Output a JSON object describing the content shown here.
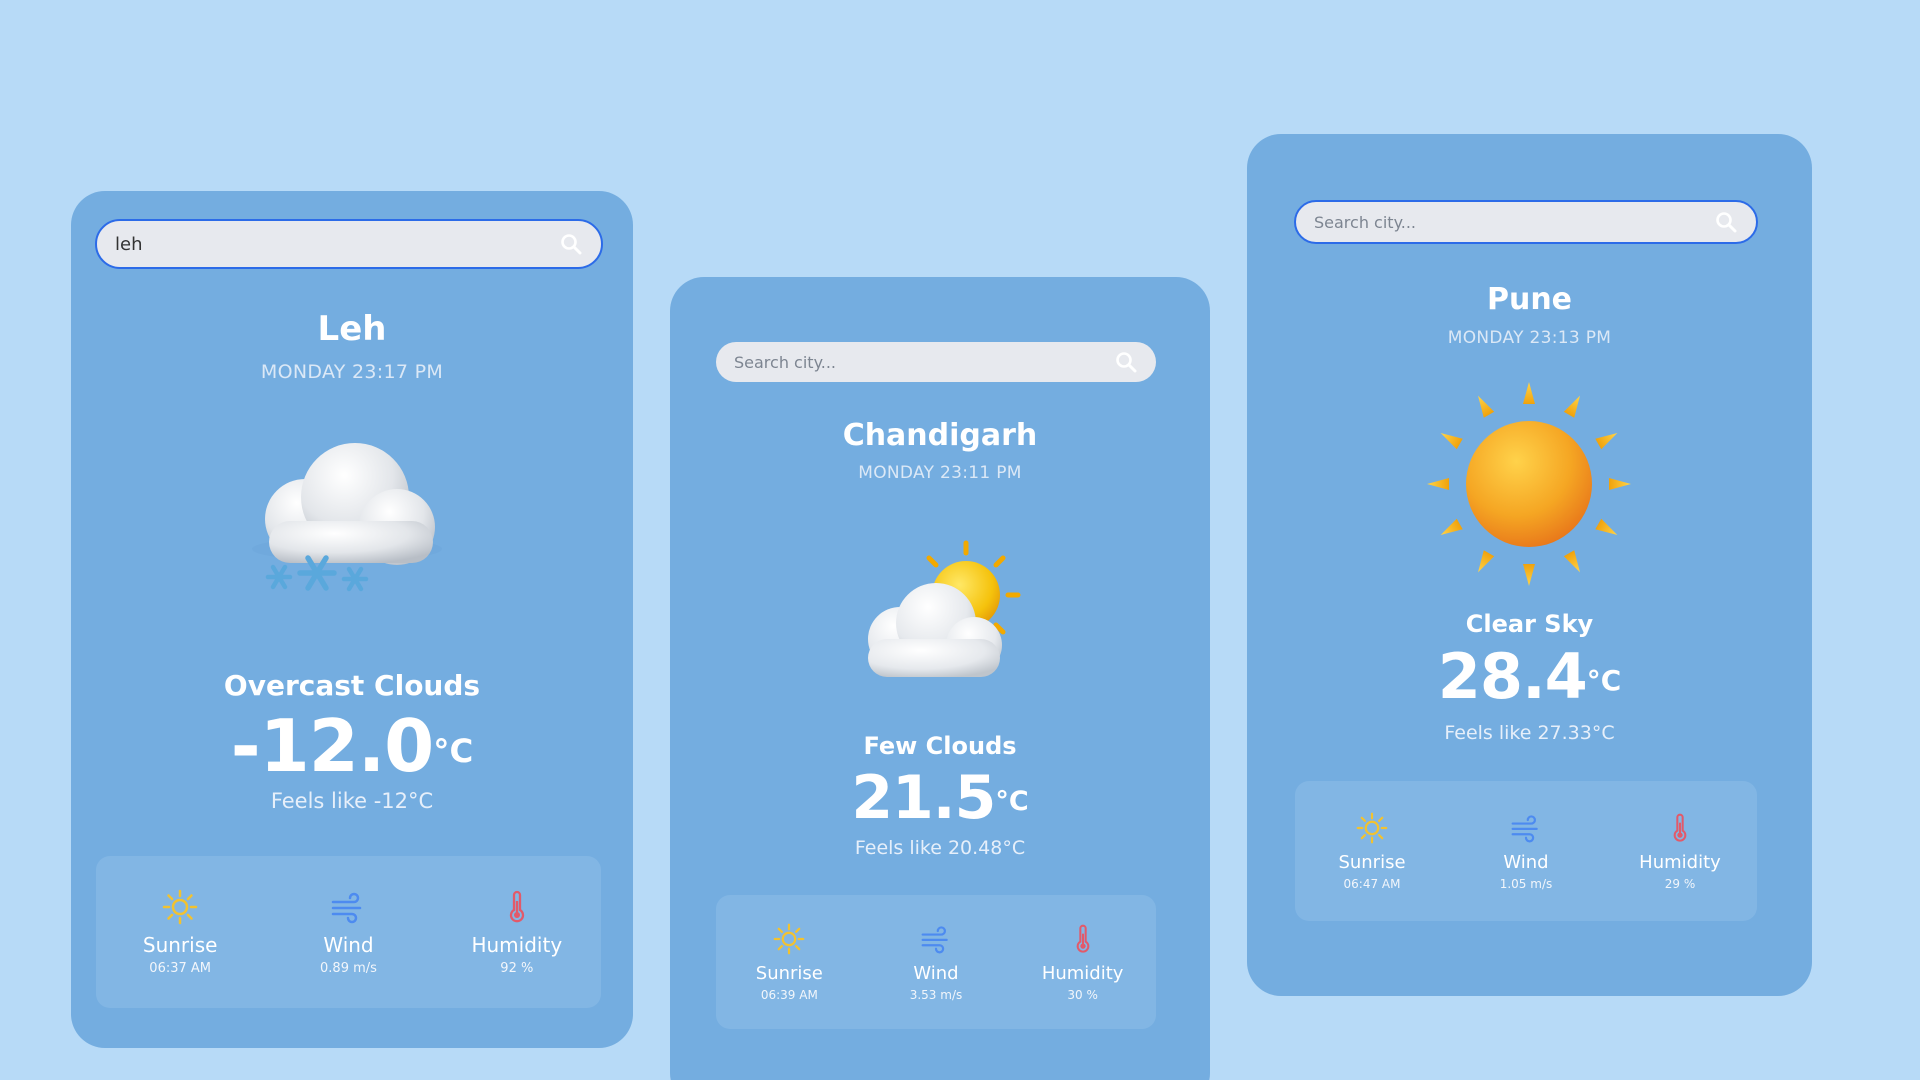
{
  "cards": {
    "leh": {
      "search_value": "leh",
      "search_placeholder": "Search city...",
      "city": "Leh",
      "datetime": "MONDAY 23:17 PM",
      "condition": "Overcast Clouds",
      "temp": "-12.0",
      "temp_unit": "°C",
      "feels": "Feels like -12°C",
      "sunrise_label": "Sunrise",
      "sunrise_value": "06:37 AM",
      "wind_label": "Wind",
      "wind_value": "0.89 m/s",
      "humidity_label": "Humidity",
      "humidity_value": "92 %"
    },
    "chandigarh": {
      "search_placeholder": "Search city...",
      "city": "Chandigarh",
      "datetime": "MONDAY 23:11 PM",
      "condition": "Few Clouds",
      "temp": "21.5",
      "temp_unit": "°C",
      "feels": "Feels like 20.48°C",
      "sunrise_label": "Sunrise",
      "sunrise_value": "06:39 AM",
      "wind_label": "Wind",
      "wind_value": "3.53 m/s",
      "humidity_label": "Humidity",
      "humidity_value": "30 %"
    },
    "pune": {
      "search_placeholder": "Search city...",
      "city": "Pune",
      "datetime": "MONDAY 23:13 PM",
      "condition": "Clear Sky",
      "temp": "28.4",
      "temp_unit": "°C",
      "feels": "Feels like 27.33°C",
      "sunrise_label": "Sunrise",
      "sunrise_value": "06:47 AM",
      "wind_label": "Wind",
      "wind_value": "1.05 m/s",
      "humidity_label": "Humidity",
      "humidity_value": "29 %"
    }
  },
  "icons": {
    "search": "search-icon",
    "snow_cloud": "snow-cloud-icon",
    "partly_cloudy": "partly-cloudy-icon",
    "sun": "sun-icon",
    "sunrise": "sunrise-icon",
    "wind": "wind-icon",
    "humidity": "thermometer-icon"
  },
  "colors": {
    "page_background": "#b7daf7",
    "card_background": "#74ade0",
    "stats_background": "#82b6e4",
    "search_background": "#e7e9ee",
    "focus_border": "#2c6be8",
    "sun_icon": "#f2c230",
    "wind_icon": "#4d8bf0",
    "humidity_icon": "#e25a6a"
  }
}
